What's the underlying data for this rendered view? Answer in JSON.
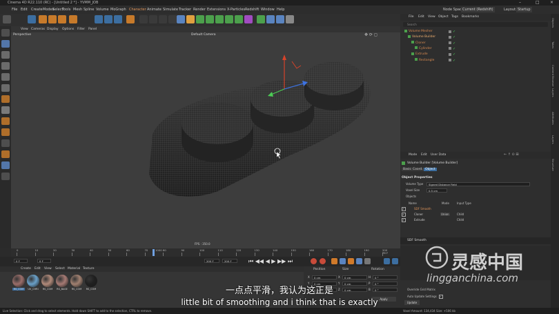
{
  "window": {
    "title": "Cinema 4D R22.110 (RC) - [Untitled 2 *] - YVMM_JOB"
  },
  "menu": [
    "File",
    "Edit",
    "Create",
    "Modes",
    "Select",
    "Tools",
    "Mesh",
    "Spline",
    "Volume",
    "MoGraph",
    "Character",
    "Animate",
    "Simulate",
    "Tracker",
    "Render",
    "Extensions",
    "X-Particles",
    "Redshift",
    "Window",
    "Help"
  ],
  "menu_right": {
    "node_space_label": "Node Space:",
    "node_space_value": "Current (Redshift)",
    "layout_label": "Layout:",
    "layout_value": "Startup"
  },
  "viewport": {
    "menu": [
      "View",
      "Cameras",
      "Display",
      "Options",
      "Filter",
      "Panel"
    ],
    "name": "Perspective",
    "camera": "Default Camera",
    "fps": "FPS : 350.0"
  },
  "timeline": {
    "ticks": [
      "0",
      "10",
      "20",
      "30",
      "40",
      "50",
      "60",
      "70",
      "80",
      "90",
      "100",
      "110",
      "120",
      "130",
      "140",
      "150",
      "160",
      "170",
      "180",
      "190",
      "200"
    ],
    "current_frame_marker": "1000",
    "end_label": "76 F"
  },
  "transport": {
    "start": "0 F",
    "current": "0 F",
    "end": "200 F",
    "end2": "200 F"
  },
  "materials": {
    "menu": [
      "Create",
      "Edit",
      "View",
      "Select",
      "Material",
      "Texture"
    ],
    "items": [
      {
        "label": "RS_COM",
        "color": "#9a6e6a"
      },
      {
        "label": "UV_CHRI",
        "color": "#6aa0c8"
      },
      {
        "label": "RS_COM",
        "color": "#b08a7a"
      },
      {
        "label": "RS_BASE",
        "color": "#a67a74"
      },
      {
        "label": "RS_COM",
        "color": "#a08070"
      },
      {
        "label": "RS_COM",
        "color": "#202020"
      }
    ]
  },
  "coords": {
    "headers": [
      "Position",
      "Size",
      "Rotation"
    ],
    "rows": [
      {
        "axis": "X",
        "pos": "0 cm",
        "size_axis": "X",
        "size": "0 cm",
        "rot_axis": "H",
        "rot": "0 °"
      },
      {
        "axis": "Y",
        "pos": "0 cm",
        "size_axis": "Y",
        "size": "0 cm",
        "rot_axis": "P",
        "rot": "0 °"
      },
      {
        "axis": "Z",
        "pos": "0 cm",
        "size_axis": "Z",
        "size": "0 cm",
        "rot_axis": "B",
        "rot": "0 °"
      }
    ],
    "apply": "Apply"
  },
  "objects": {
    "menu": [
      "File",
      "Edit",
      "View",
      "Object",
      "Tags",
      "Bookmarks"
    ],
    "search_placeholder": "Search",
    "rows": [
      {
        "name": "Volume Mesher",
        "indent": 0
      },
      {
        "name": "Volume Builder",
        "indent": 1
      },
      {
        "name": "Cloner",
        "indent": 2
      },
      {
        "name": "Cylinder",
        "indent": 3
      },
      {
        "name": "Extrude",
        "indent": 2
      },
      {
        "name": "Rectangle",
        "indent": 3
      }
    ]
  },
  "attributes": {
    "menu": [
      "Mode",
      "Edit",
      "User Data"
    ],
    "title": "Volume Builder [Volume Builder]",
    "tabs": [
      "Basic",
      "Coord.",
      "Object"
    ],
    "section": "Object Properties",
    "volume_type_label": "Volume Type",
    "volume_type_value": "Signed Distance Field",
    "voxel_size_label": "Voxel Size",
    "voxel_size_value": "0.5 cm",
    "objects_label": "Objects",
    "list_headers": [
      "Name",
      "Mode",
      "Input Type"
    ],
    "list_rows": [
      {
        "name": "SDF Smooth",
        "mode": "",
        "type": ""
      },
      {
        "name": "Cloner",
        "mode": "Union",
        "type": "Child"
      },
      {
        "name": "Extrude",
        "mode": "",
        "type": "Child"
      }
    ],
    "sdf_smooth_label": "SDF Smooth",
    "override_label": "Override Grid Matrix",
    "auto_update_label": "Auto Update Settings",
    "update_button": "Update"
  },
  "right_tabs": [
    "Objects",
    "Takes",
    "Content Browser",
    "Layers",
    "Attributes",
    "Layers",
    "Structure"
  ],
  "statusbar": {
    "left": "Live Selection: Click and drag to select elements. Hold down SHIFT to add to the selection, CTRL to remove.",
    "right": "Voxel Amount: 134,434 Size: +506 kb"
  },
  "subtitle": {
    "cn": "一点点平滑，我认为这正是",
    "en": "little bit of smoothing and i think that is exactly"
  },
  "watermark": {
    "cn": "灵感中国",
    "url": "lingganchina.com"
  },
  "colors": {
    "accent_orange": "#e0955a",
    "selected_blue": "#3c6ea0",
    "axis_x": "#d6432a",
    "axis_y": "#4ccc55",
    "axis_z": "#3d72e0"
  }
}
